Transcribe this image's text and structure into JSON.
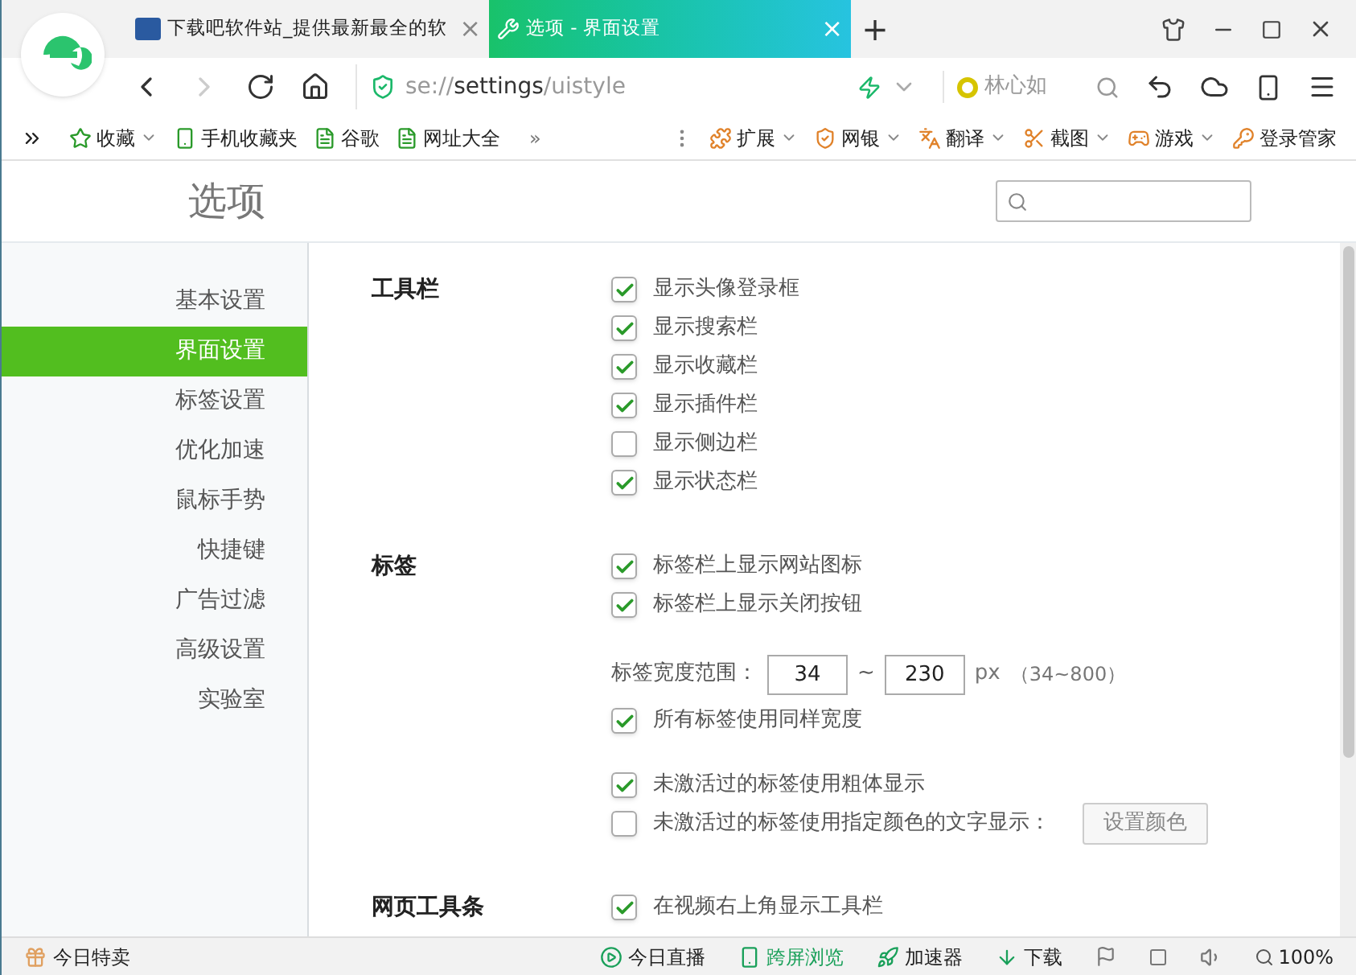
{
  "tabs": [
    {
      "title": "下载吧软件站_提供最新最全的软",
      "close": "×",
      "selected": false
    },
    {
      "title": "选项 - 界面设置",
      "close": "×",
      "selected": true
    }
  ],
  "new_tab": "+",
  "address": {
    "scheme": "se://",
    "host": "settings",
    "path": "/uistyle"
  },
  "search": {
    "value": "林心如"
  },
  "bookmarks_left": [
    {
      "label": "收藏",
      "dropdown": true
    },
    {
      "label": "手机收藏夹",
      "dropdown": false
    },
    {
      "label": "谷歌",
      "dropdown": false
    },
    {
      "label": "网址大全",
      "dropdown": false
    }
  ],
  "bookmarks_more": "»",
  "bookmarks_right": [
    {
      "label": "扩展",
      "dropdown": true
    },
    {
      "label": "网银",
      "dropdown": true
    },
    {
      "label": "翻译",
      "dropdown": true
    },
    {
      "label": "截图",
      "dropdown": true
    },
    {
      "label": "游戏",
      "dropdown": true
    },
    {
      "label": "登录管家",
      "dropdown": false
    }
  ],
  "page_title": "选项",
  "sidebar": {
    "items": [
      {
        "label": "基本设置",
        "selected": false
      },
      {
        "label": "界面设置",
        "selected": true
      },
      {
        "label": "标签设置",
        "selected": false
      },
      {
        "label": "优化加速",
        "selected": false
      },
      {
        "label": "鼠标手势",
        "selected": false
      },
      {
        "label": "快捷键",
        "selected": false
      },
      {
        "label": "广告过滤",
        "selected": false
      },
      {
        "label": "高级设置",
        "selected": false
      },
      {
        "label": "实验室",
        "selected": false
      }
    ]
  },
  "sections": [
    {
      "title": "工具栏",
      "groups": [
        [
          {
            "kind": "checkbox",
            "label": "显示头像登录框",
            "checked": true
          },
          {
            "kind": "checkbox",
            "label": "显示搜索栏",
            "checked": true
          },
          {
            "kind": "checkbox",
            "label": "显示收藏栏",
            "checked": true
          },
          {
            "kind": "checkbox",
            "label": "显示插件栏",
            "checked": true
          },
          {
            "kind": "checkbox",
            "label": "显示侧边栏",
            "checked": false
          },
          {
            "kind": "checkbox",
            "label": "显示状态栏",
            "checked": true
          }
        ]
      ]
    },
    {
      "title": "标签",
      "groups": [
        [
          {
            "kind": "checkbox",
            "label": "标签栏上显示网站图标",
            "checked": true
          },
          {
            "kind": "checkbox",
            "label": "标签栏上显示关闭按钮",
            "checked": true
          }
        ],
        [
          {
            "kind": "range",
            "label": "标签宽度范围：",
            "min": "34",
            "separator": "~",
            "max": "230",
            "unit": "px",
            "hint": "（34~800）"
          },
          {
            "kind": "checkbox",
            "label": "所有标签使用同样宽度",
            "checked": true
          }
        ],
        [
          {
            "kind": "checkbox",
            "label": "未激活过的标签使用粗体显示",
            "checked": true
          },
          {
            "kind": "checkbox_button",
            "label": "未激活过的标签使用指定颜色的文字显示：",
            "checked": false,
            "button": "设置颜色"
          }
        ]
      ]
    },
    {
      "title": "网页工具条",
      "groups": [
        [
          {
            "kind": "checkbox",
            "label": "在视频右上角显示工具栏",
            "checked": true
          }
        ]
      ]
    }
  ],
  "status_bar": {
    "left": "今日特卖",
    "items": [
      {
        "label": "今日直播",
        "active": false
      },
      {
        "label": "跨屏浏览",
        "active": true
      },
      {
        "label": "加速器",
        "active": false
      },
      {
        "label": "下载",
        "active": false
      }
    ],
    "zoom": "100%"
  }
}
